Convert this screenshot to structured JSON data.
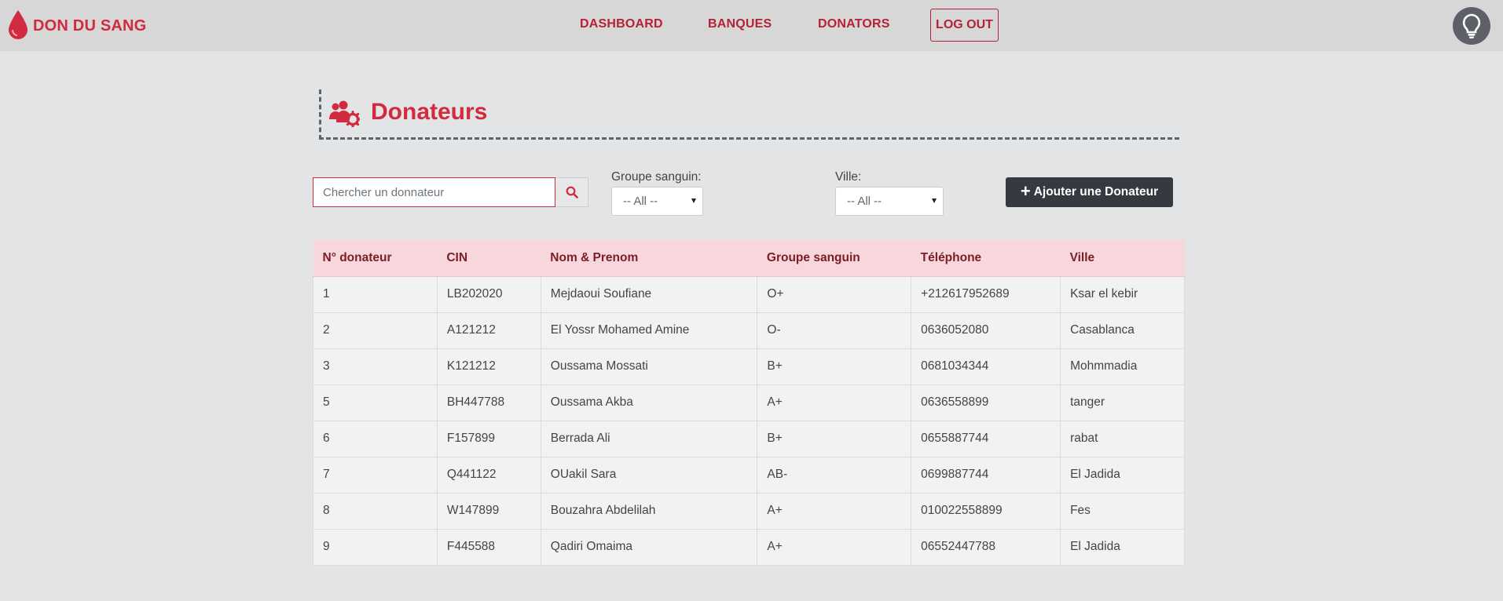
{
  "navbar": {
    "brand": "DON DU SANG",
    "links": [
      "DASHBOARD",
      "BANQUES",
      "DONATORS"
    ],
    "logout": "LOG OUT"
  },
  "page": {
    "title": "Donateurs"
  },
  "filters": {
    "search_placeholder": "Chercher un donnateur",
    "groupe_label": "Groupe sanguin:",
    "groupe_value": "-- All --",
    "ville_label": "Ville:",
    "ville_value": "-- All --",
    "add_button": "Ajouter une Donateur"
  },
  "table": {
    "headers": [
      "N° donateur",
      "CIN",
      "Nom & Prenom",
      "Groupe sanguin",
      "Téléphone",
      "Ville"
    ],
    "rows": [
      [
        "1",
        "LB202020",
        "Mejdaoui Soufiane",
        "O+",
        "+212617952689",
        "Ksar el kebir"
      ],
      [
        "2",
        "A121212",
        "El Yossr Mohamed Amine",
        "O-",
        "0636052080",
        "Casablanca"
      ],
      [
        "3",
        "K121212",
        "Oussama Mossati",
        "B+",
        "0681034344",
        "Mohmmadia"
      ],
      [
        "5",
        "BH447788",
        "Oussama Akba",
        "A+",
        "0636558899",
        "tanger"
      ],
      [
        "6",
        "F157899",
        "Berrada Ali",
        "B+",
        "0655887744",
        "rabat"
      ],
      [
        "7",
        "Q441122",
        "OUakil Sara",
        "AB-",
        "0699887744",
        "El Jadida"
      ],
      [
        "8",
        "W147899",
        "Bouzahra Abdelilah",
        "A+",
        "010022558899",
        "Fes"
      ],
      [
        "9",
        "F445588",
        "Qadiri Omaima",
        "A+",
        "06552447788",
        "El Jadida"
      ]
    ]
  },
  "colors": {
    "accent": "#d22a3f",
    "header_bg": "#f7d7db",
    "dark_button": "#343a40"
  },
  "icons": {
    "brand": "blood-drop-icon",
    "title": "users-cog-icon",
    "search": "search-icon",
    "help": "lightbulb-icon",
    "add": "plus-icon"
  }
}
